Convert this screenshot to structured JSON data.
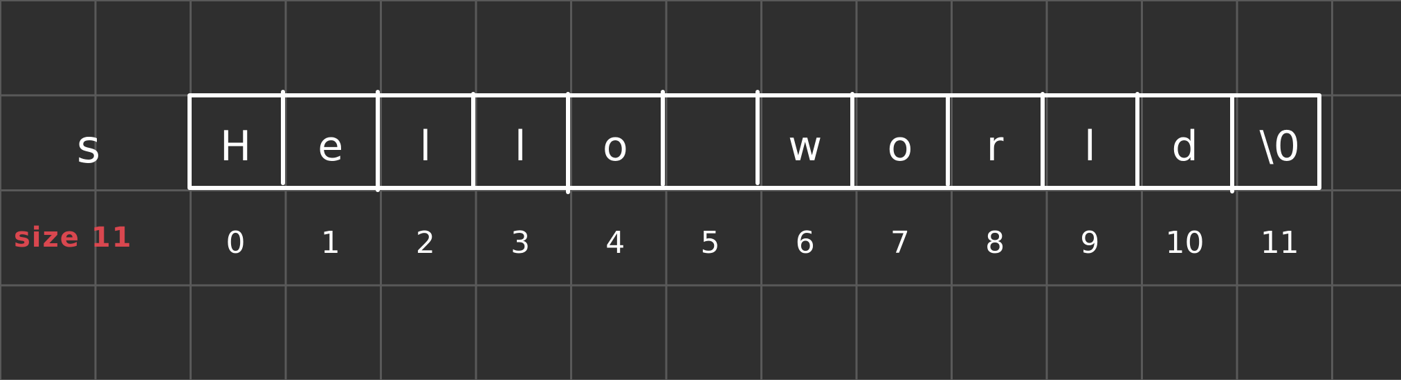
{
  "diagram": {
    "variable_name": "s",
    "size_label": "size 11",
    "cells": [
      {
        "char": "H",
        "index": "0"
      },
      {
        "char": "e",
        "index": "1"
      },
      {
        "char": "l",
        "index": "2"
      },
      {
        "char": "l",
        "index": "3"
      },
      {
        "char": "o",
        "index": "4"
      },
      {
        "char": " ",
        "index": "5"
      },
      {
        "char": "w",
        "index": "6"
      },
      {
        "char": "o",
        "index": "7"
      },
      {
        "char": "r",
        "index": "8"
      },
      {
        "char": "l",
        "index": "9"
      },
      {
        "char": "d",
        "index": "10"
      },
      {
        "char": "\\0",
        "index": "11"
      }
    ],
    "colors": {
      "background": "#2f2f2f",
      "grid": "#595959",
      "ink": "#ffffff",
      "accent": "#d9474f"
    }
  }
}
